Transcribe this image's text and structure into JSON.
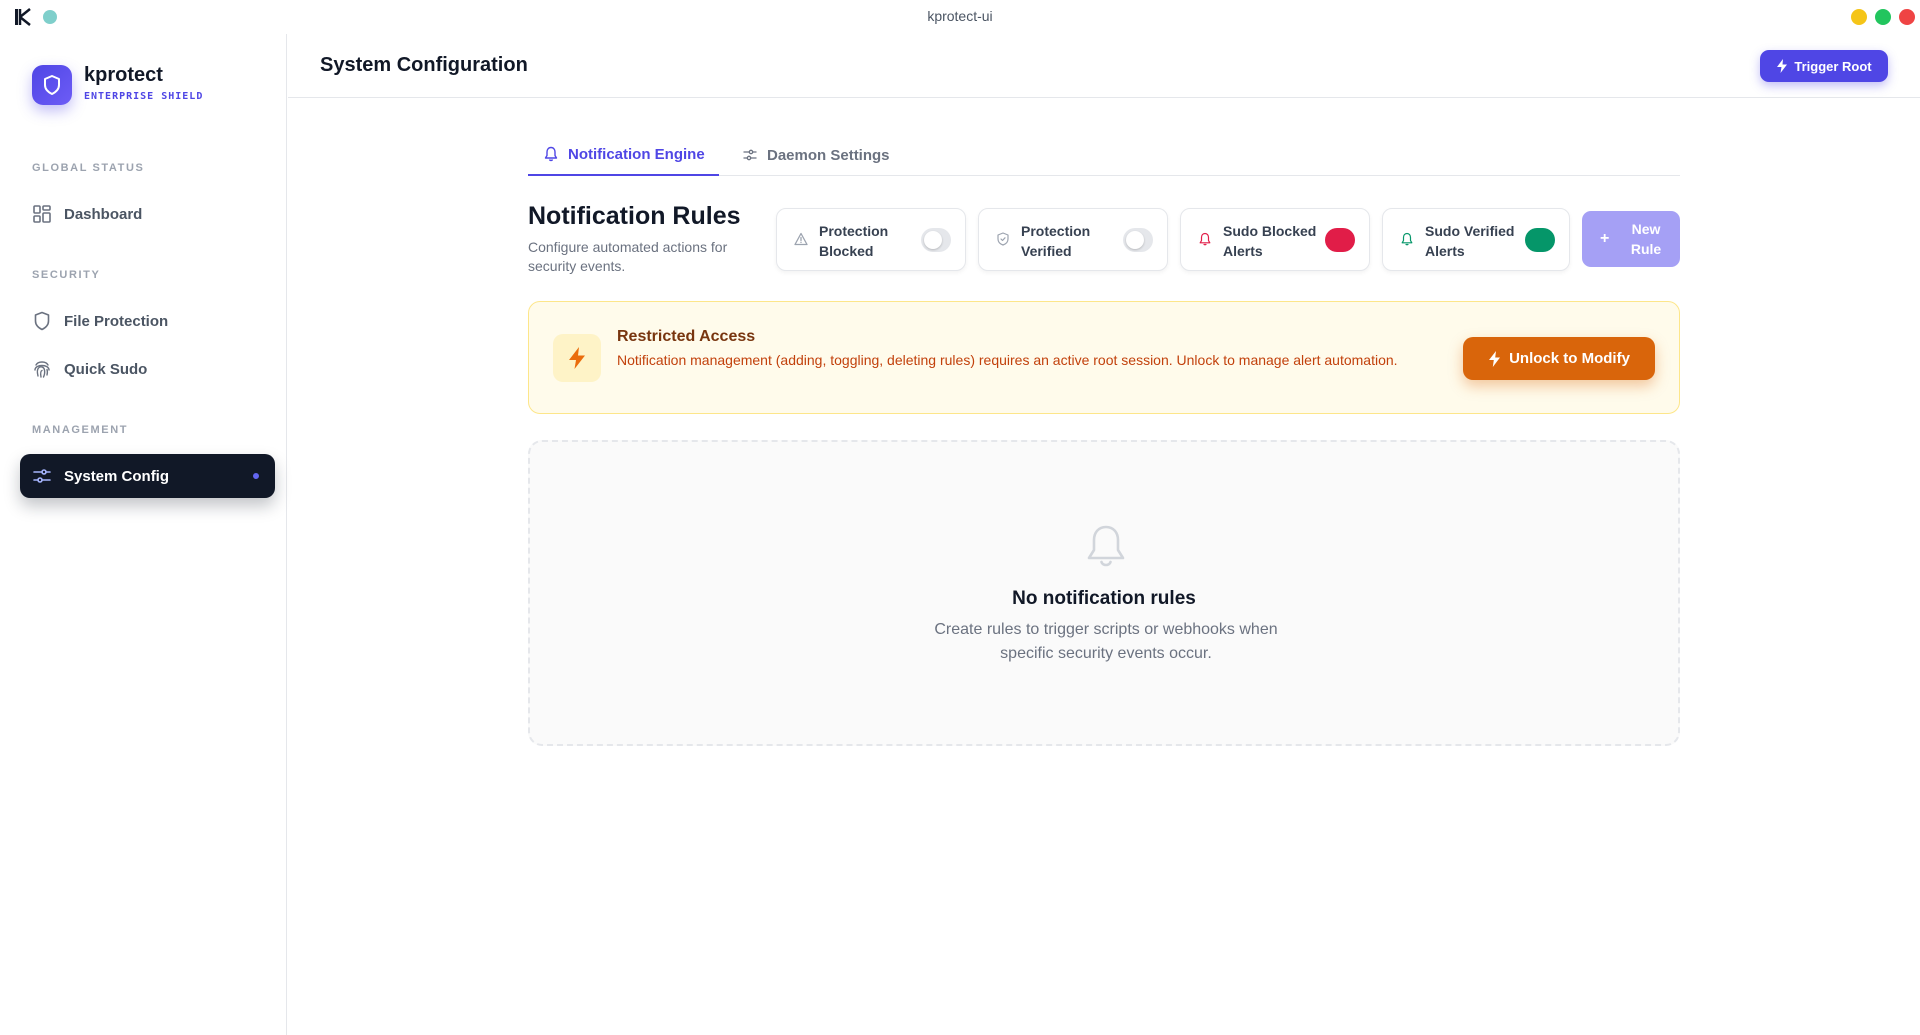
{
  "window": {
    "title": "kprotect-ui"
  },
  "brand": {
    "name": "kprotect",
    "subtitle": "ENTERPRISE SHIELD"
  },
  "sidebar": {
    "sections": [
      {
        "label": "GLOBAL STATUS",
        "items": [
          {
            "label": "Dashboard",
            "icon": "dashboard-grid-icon"
          }
        ]
      },
      {
        "label": "SECURITY",
        "items": [
          {
            "label": "File Protection",
            "icon": "shield-icon"
          },
          {
            "label": "Quick Sudo",
            "icon": "fingerprint-icon"
          }
        ]
      },
      {
        "label": "MANAGEMENT",
        "items": [
          {
            "label": "System Config",
            "icon": "sliders-icon",
            "active": true
          }
        ]
      }
    ]
  },
  "header": {
    "title": "System Configuration",
    "trigger_label": "Trigger Root"
  },
  "tabs": [
    {
      "label": "Notification Engine",
      "icon": "bell-icon",
      "active": true
    },
    {
      "label": "Daemon Settings",
      "icon": "sliders-icon",
      "active": false
    }
  ],
  "rules": {
    "title": "Notification Rules",
    "description": "Configure automated actions for security events.",
    "filters": [
      {
        "line1": "Protection",
        "line2": "Blocked",
        "icon": "warning-triangle-icon",
        "state": "off"
      },
      {
        "line1": "Protection",
        "line2": "Verified",
        "icon": "shield-check-icon",
        "state": "off"
      },
      {
        "line1": "Sudo Blocked",
        "line2": "Alerts",
        "icon": "bell-icon",
        "state": "on",
        "color": "#e11d48"
      },
      {
        "line1": "Sudo Verified",
        "line2": "Alerts",
        "icon": "bell-icon",
        "state": "on",
        "color": "#059669"
      }
    ],
    "new_rule": {
      "line1": "New",
      "line2": "Rule"
    }
  },
  "banner": {
    "title": "Restricted Access",
    "text": "Notification management (adding, toggling, deleting rules) requires an active root session. Unlock to manage alert automation.",
    "button": "Unlock to Modify"
  },
  "empty": {
    "title": "No notification rules",
    "text": "Create rules to trigger scripts or webhooks when specific security events occur."
  },
  "colors": {
    "accent": "#4f46e5",
    "warning": "#d9650b",
    "danger": "#e11d48",
    "success": "#059669"
  }
}
